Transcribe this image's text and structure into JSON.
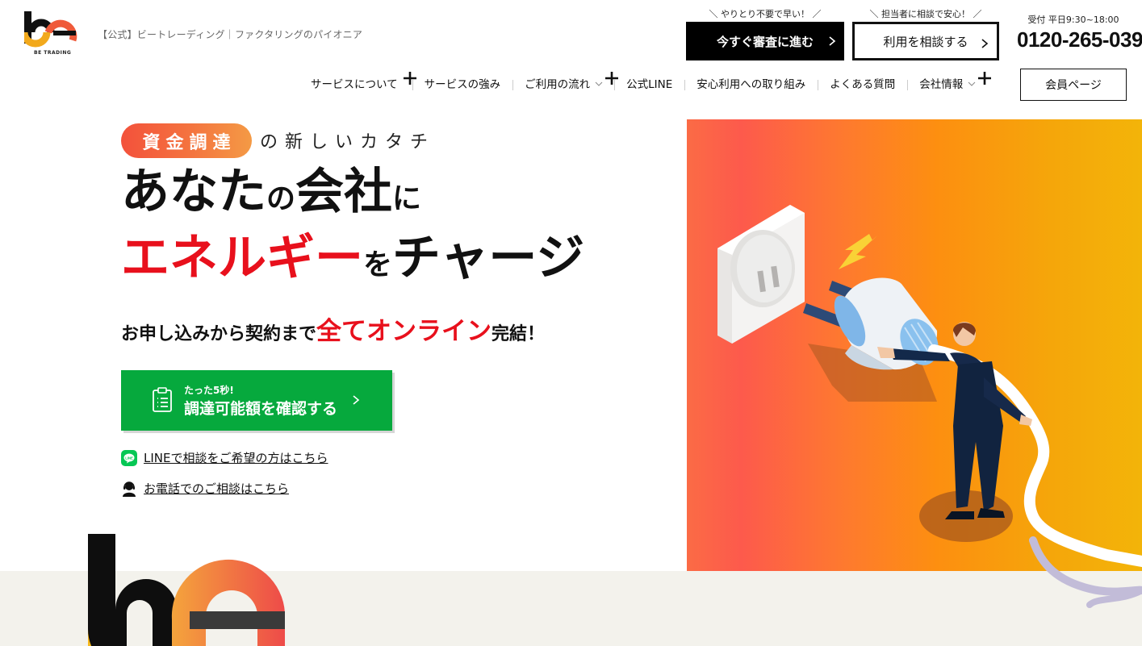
{
  "header": {
    "logo_caption": "BE TRADING",
    "site_title": "【公式】ビートレーディング｜ファクタリングのパイオニア",
    "cta_review": {
      "note": "＼ やりとり不要で早い！ ／",
      "label": "今すぐ審査に進む"
    },
    "cta_consult": {
      "note": "＼ 担当者に相談で安心！ ／",
      "label": "利用を相談する"
    },
    "phone": {
      "hours": "受付 平日9:30~18:00",
      "number": "0120-265-039"
    }
  },
  "nav": {
    "items": [
      {
        "label": "サービスについて",
        "expand": "plus"
      },
      {
        "label": "サービスの強み"
      },
      {
        "label": "ご利用の流れ",
        "expand": "plus"
      },
      {
        "label": "公式LINE"
      },
      {
        "label": "安心利用への取り組み"
      },
      {
        "label": "よくある質問"
      },
      {
        "label": "会社情報",
        "expand": "plus"
      }
    ],
    "member_label": "会員ページ"
  },
  "hero": {
    "tag": "資金調達",
    "tag_after": "の新しいカタチ",
    "headline": {
      "l1_a": "あなた",
      "l1_b": "の",
      "l1_c": "会社",
      "l1_d": "に",
      "l2_a": "エネルギー",
      "l2_b": "を",
      "l2_c": "チャージ"
    },
    "sub": {
      "a": "お申し込みから契約まで",
      "b": "全てオンライン",
      "c": "完結！"
    },
    "check_button": {
      "small": "たった5秒!",
      "big": "調達可能額を確認する"
    },
    "link_line": "LINEで相談をご希望の方はこちら",
    "link_tel": "お電話でのご相談はこちら"
  },
  "colors": {
    "accent_red": "#e8101c",
    "green": "#06a93d",
    "hero_gradient_start": "#fb6b45",
    "hero_gradient_end": "#f3b409",
    "band": "#f3f2ec"
  },
  "icons": [
    "chevron-right-icon",
    "plus-icon",
    "chevron-down-icon",
    "clipboard-icon",
    "line-icon",
    "headset-icon"
  ]
}
